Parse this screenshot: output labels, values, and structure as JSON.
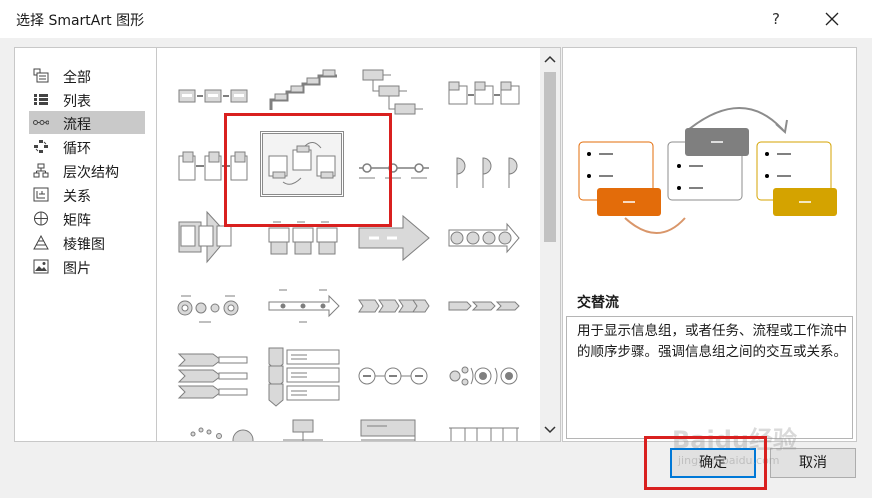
{
  "dialog": {
    "title": "选择 SmartArt 图形",
    "help_label": "?"
  },
  "categories": [
    {
      "label": "全部",
      "icon": "all-icon"
    },
    {
      "label": "列表",
      "icon": "list-icon"
    },
    {
      "label": "流程",
      "icon": "process-icon",
      "selected": true
    },
    {
      "label": "循环",
      "icon": "cycle-icon"
    },
    {
      "label": "层次结构",
      "icon": "hierarchy-icon"
    },
    {
      "label": "关系",
      "icon": "relationship-icon"
    },
    {
      "label": "矩阵",
      "icon": "matrix-icon"
    },
    {
      "label": "棱锥图",
      "icon": "pyramid-icon"
    },
    {
      "label": "图片",
      "icon": "picture-icon"
    }
  ],
  "preview": {
    "title": "交替流",
    "description": "用于显示信息组，或者任务、流程或工作流中的顺序步骤。强调信息组之间的交互或关系。",
    "bullet": "—"
  },
  "buttons": {
    "ok": "确定",
    "cancel": "取消"
  },
  "watermark": {
    "text": "Baidu经验",
    "sub": "jingyan.baidu.com"
  },
  "colors": {
    "selected_bg": "#c9c9c9",
    "annotation_red": "#d9201f",
    "preview_orange": "#e36c0a",
    "preview_gray": "#7f7f7f",
    "preview_gold": "#d4a300",
    "ok_border": "#0078d7"
  }
}
